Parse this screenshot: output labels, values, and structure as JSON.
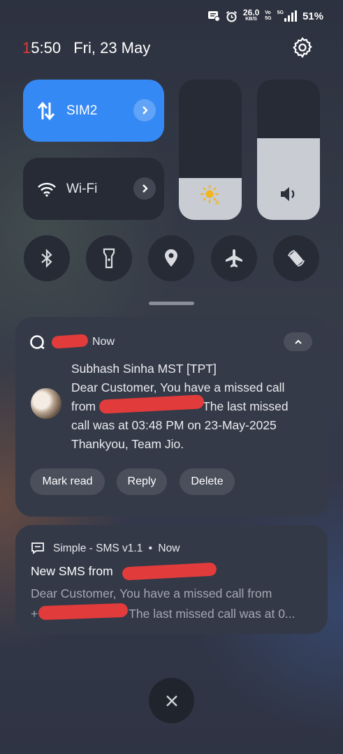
{
  "status_bar": {
    "speed_value": "26.0",
    "speed_unit": "KB/S",
    "vo_top": "Vo",
    "vo_bottom": "5G",
    "network": "5G",
    "battery": "51%"
  },
  "header": {
    "time_first": "1",
    "time_rest": "5:50",
    "date": "Fri, 23 May"
  },
  "tiles": {
    "sim_label": "SIM2",
    "wifi_label": "Wi-Fi"
  },
  "sliders": {
    "brightness_level": 0.3,
    "volume_level": 0.58
  },
  "toggles": [
    "bluetooth-icon",
    "flashlight-icon",
    "location-icon",
    "airplane-icon",
    "auto-rotate-icon"
  ],
  "notification1": {
    "time": "Now",
    "sender": "Subhash Sinha MST [TPT]",
    "line1": "Dear Customer, You have a missed call",
    "line2_start": "from +",
    "line2_end": "The last missed",
    "line3": "call was at 03:48 PM on 23-May-2025",
    "line4": "Thankyou, Team Jio.",
    "actions": {
      "mark_read": "Mark read",
      "reply": "Reply",
      "delete": "Delete"
    }
  },
  "notification2": {
    "app": "Simple - SMS v1.1",
    "separator": "•",
    "time": "Now",
    "title": "New SMS from",
    "line1": "Dear Customer, You have a missed call from",
    "line2_start": "+",
    "line2_end": "The last missed call was at 0..."
  },
  "colors": {
    "accent": "#3589f5",
    "redaction": "#e23b3b",
    "slider_fill": "#c9ccd3"
  }
}
